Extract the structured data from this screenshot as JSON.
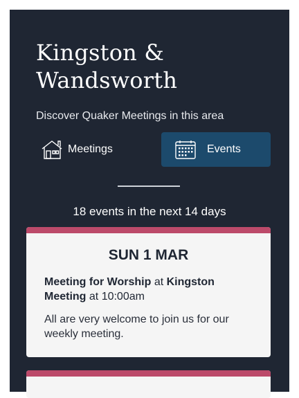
{
  "header": {
    "title": "Kingston & Wandsworth",
    "subtitle": "Discover Quaker Meetings in this area"
  },
  "tabs": [
    {
      "label": "Meetings",
      "icon": "house-icon",
      "active": false
    },
    {
      "label": "Events",
      "icon": "calendar-icon",
      "active": true
    }
  ],
  "events_summary": "18 events in the next 14 days",
  "events": [
    {
      "date": "SUN 1 MAR",
      "title": "Meeting for Worship",
      "at1": " at ",
      "location": "Kingston Meeting",
      "at2": " at 10:00am",
      "description": "All are very welcome to join us for our weekly meeting."
    }
  ],
  "colors": {
    "background": "#1f2633",
    "active_tab": "#1c4a6c",
    "card_accent": "#bc4a6a",
    "card": "#f5f5f5"
  }
}
